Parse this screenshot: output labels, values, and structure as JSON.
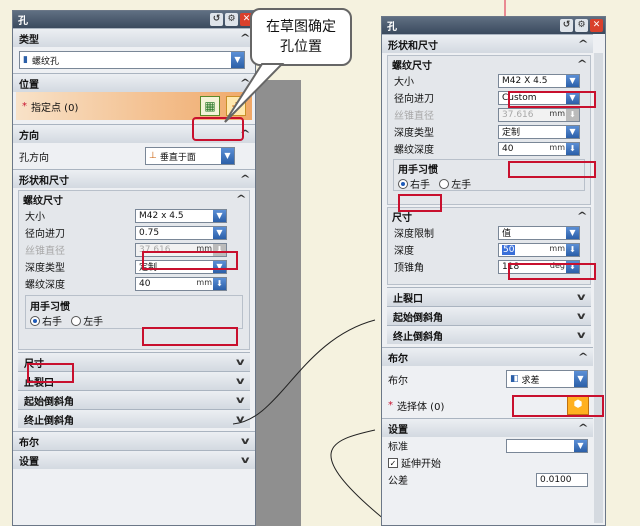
{
  "left": {
    "title": "孔",
    "type_header": "类型",
    "type_value": "螺纹孔",
    "pos_header": "位置",
    "pos_label": "指定点 (0)",
    "dir_header": "方向",
    "dir_label": "孔方向",
    "dir_value": "垂直于面",
    "shape_header": "形状和尺寸",
    "thread_header": "螺纹尺寸",
    "size_label": "大小",
    "size_value": "M42 x 4.5",
    "radial_label": "径向进刀",
    "radial_value": "0.75",
    "taper_label": "丝锥直径",
    "taper_value": "37.616",
    "taper_unit": "mm",
    "depthtype_label": "深度类型",
    "depthtype_value": "定制",
    "threaddepth_label": "螺纹深度",
    "threaddepth_value": "40",
    "threaddepth_unit": "mm",
    "hand_header": "用手习惯",
    "right_hand": "右手",
    "left_hand": "左手",
    "dim_label": "尺寸",
    "relief_label": "止裂口",
    "start_label": "起始倒斜角",
    "end_label": "终止倒斜角",
    "bool_label": "布尔",
    "settings_label": "设置"
  },
  "right": {
    "title": "孔",
    "shape_header": "形状和尺寸",
    "thread_header": "螺纹尺寸",
    "size_label": "大小",
    "size_value": "M42 X 4.5",
    "radial_label": "径向进刀",
    "radial_value": "Custom",
    "taper_label": "丝锥直径",
    "taper_value": "37.616",
    "taper_unit": "mm",
    "depthtype_label": "深度类型",
    "depthtype_value": "定制",
    "threaddepth_label": "螺纹深度",
    "threaddepth_value": "40",
    "threaddepth_unit": "mm",
    "hand_header": "用手习惯",
    "right_hand": "右手",
    "left_hand": "左手",
    "dim_header": "尺寸",
    "limit_label": "深度限制",
    "limit_value": "值",
    "depth_label": "深度",
    "depth_value": "50",
    "depth_unit": "mm",
    "tip_label": "顶锥角",
    "tip_value": "118",
    "tip_unit": "deg",
    "relief_label": "止裂口",
    "start_label": "起始倒斜角",
    "end_label": "终止倒斜角",
    "bool_header": "布尔",
    "bool_label": "布尔",
    "bool_value": "求差",
    "select_body": "选择体 (0)",
    "settings_header": "设置",
    "standard_label": "标准",
    "extend_label": "延伸开始",
    "tolerance_label": "公差",
    "tolerance_value": "0.0100"
  },
  "callout": "在草图确定孔位置",
  "colors": {
    "highlight": "#c8102e",
    "title": "#3b4a5e"
  }
}
